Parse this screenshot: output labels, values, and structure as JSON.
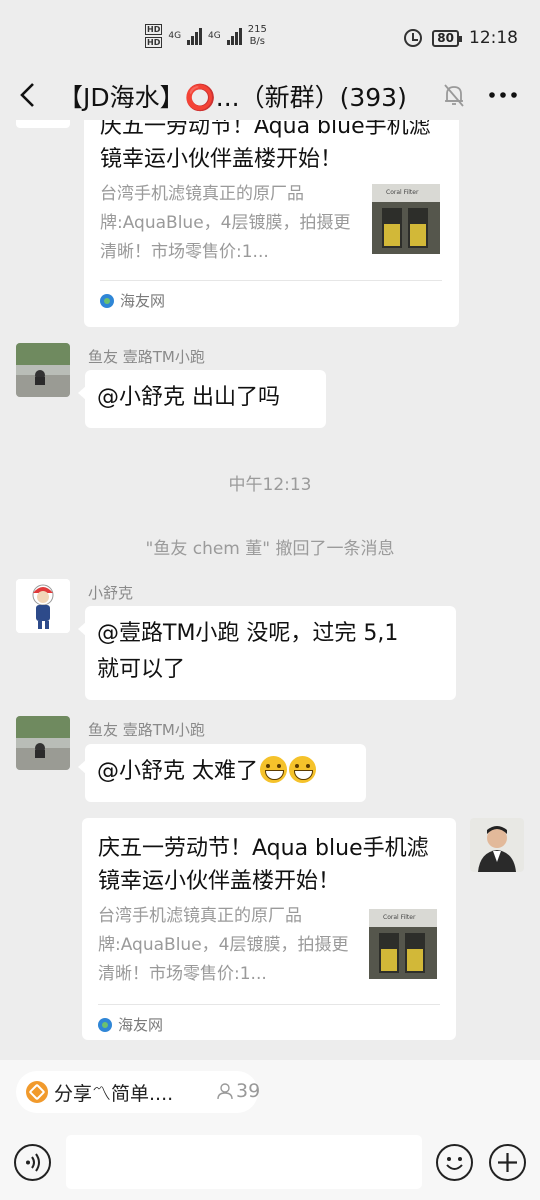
{
  "status_bar": {
    "net_speed_value": "215",
    "net_speed_unit": "B/s",
    "network_type": "4G",
    "hd_label": "HD",
    "battery": "80",
    "time": "12:18"
  },
  "nav": {
    "title": "【JD海水】⭕...（新群）(393)"
  },
  "messages": {
    "card_top": {
      "title": "庆五一劳动节！Aqua blue手机滤镜幸运小伙伴盖楼开始！",
      "desc": "台湾手机滤镜真正的原厂品牌:AquaBlue，4层镀膜，拍摄更清晰！市场零售价:1...",
      "source": "海友网",
      "thumb_label": "Coral Filter"
    },
    "msg1": {
      "sender": "鱼友 壹路TM小跑",
      "text": "@小舒克  出山了吗"
    },
    "time_divider": "中午12:13",
    "recall_note": "\"鱼友 chem 董\" 撤回了一条消息",
    "msg2": {
      "sender": "小舒克",
      "text_line1": "@壹路TM小跑  没呢，过完 5,1",
      "text_line2": "就可以了"
    },
    "msg3": {
      "sender": "鱼友 壹路TM小跑",
      "text": "@小舒克  太难了"
    },
    "card_bottom": {
      "title": "庆五一劳动节！Aqua blue手机滤镜幸运小伙伴盖楼开始！",
      "desc": "台湾手机滤镜真正的原厂品牌:AquaBlue，4层镀膜，拍摄更清晰！市场零售价:1...",
      "source": "海友网",
      "thumb_label": "Coral Filter"
    }
  },
  "bottom": {
    "pill_text": "分享〽简单....",
    "pill_count": "39"
  }
}
